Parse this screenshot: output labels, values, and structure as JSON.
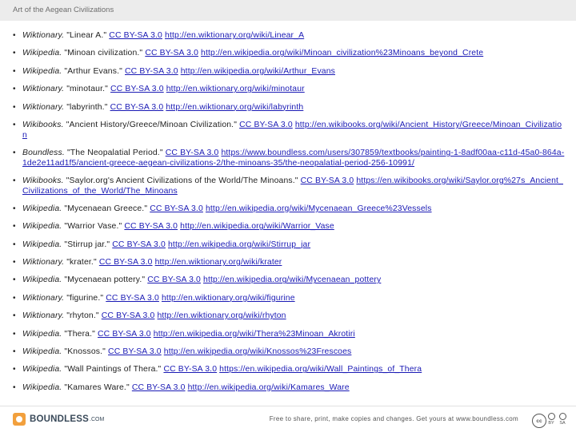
{
  "header": {
    "title": "Art of the Aegean Civilizations"
  },
  "references": [
    {
      "source": "Wiktionary.",
      "title": " \"Linear A.\" ",
      "license": "CC BY-SA 3.0",
      "url": "http://en.wiktionary.org/wiki/Linear_A"
    },
    {
      "source": "Wikipedia.",
      "title": " \"Minoan civilization.\" ",
      "license": "CC BY-SA 3.0",
      "url": "http://en.wikipedia.org/wiki/Minoan_civilization%23Minoans_beyond_Crete"
    },
    {
      "source": "Wikipedia.",
      "title": " \"Arthur Evans.\" ",
      "license": "CC BY-SA 3.0",
      "url": "http://en.wikipedia.org/wiki/Arthur_Evans"
    },
    {
      "source": "Wiktionary.",
      "title": " \"minotaur.\" ",
      "license": "CC BY-SA 3.0",
      "url": "http://en.wiktionary.org/wiki/minotaur"
    },
    {
      "source": "Wiktionary.",
      "title": " \"labyrinth.\" ",
      "license": "CC BY-SA 3.0",
      "url": "http://en.wiktionary.org/wiki/labyrinth"
    },
    {
      "source": "Wikibooks.",
      "title": " \"Ancient History/Greece/Minoan Civilization.\" ",
      "license": "CC BY-SA 3.0",
      "url": "http://en.wikibooks.org/wiki/Ancient_History/Greece/Minoan_Civilization"
    },
    {
      "source": "Boundless.",
      "title": " \"The Neopalatial Period.\" ",
      "license": "CC BY-SA 3.0",
      "url": "https://www.boundless.com/users/307859/textbooks/painting-1-8adf00aa-c11d-45a0-864a-1de2e11ad1f5/ancient-greece-aegean-civilizations-2/the-minoans-35/the-neopalatial-period-256-10991/"
    },
    {
      "source": "Wikibooks.",
      "title": " \"Saylor.org's Ancient Civilizations of the World/The Minoans.\" ",
      "license": "CC BY-SA 3.0",
      "url": "https://en.wikibooks.org/wiki/Saylor.org%27s_Ancient_Civilizations_of_the_World/The_Minoans"
    },
    {
      "source": "Wikipedia.",
      "title": " \"Mycenaean Greece.\" ",
      "license": "CC BY-SA 3.0",
      "url": "http://en.wikipedia.org/wiki/Mycenaean_Greece%23Vessels"
    },
    {
      "source": "Wikipedia.",
      "title": " \"Warrior Vase.\" ",
      "license": "CC BY-SA 3.0",
      "url": "http://en.wikipedia.org/wiki/Warrior_Vase"
    },
    {
      "source": "Wikipedia.",
      "title": " \"Stirrup jar.\" ",
      "license": "CC BY-SA 3.0",
      "url": "http://en.wikipedia.org/wiki/Stirrup_jar"
    },
    {
      "source": "Wiktionary.",
      "title": " \"krater.\" ",
      "license": "CC BY-SA 3.0",
      "url": "http://en.wiktionary.org/wiki/krater"
    },
    {
      "source": "Wikipedia.",
      "title": " \"Mycenaean pottery.\" ",
      "license": "CC BY-SA 3.0",
      "url": "http://en.wikipedia.org/wiki/Mycenaean_pottery"
    },
    {
      "source": "Wiktionary.",
      "title": " \"figurine.\" ",
      "license": "CC BY-SA 3.0",
      "url": "http://en.wiktionary.org/wiki/figurine"
    },
    {
      "source": "Wiktionary.",
      "title": " \"rhyton.\" ",
      "license": "CC BY-SA 3.0",
      "url": "http://en.wiktionary.org/wiki/rhyton"
    },
    {
      "source": "Wikipedia.",
      "title": " \"Thera.\" ",
      "license": "CC BY-SA 3.0",
      "url": "http://en.wikipedia.org/wiki/Thera%23Minoan_Akrotiri"
    },
    {
      "source": "Wikipedia.",
      "title": " \"Knossos.\" ",
      "license": "CC BY-SA 3.0",
      "url": "http://en.wikipedia.org/wiki/Knossos%23Frescoes"
    },
    {
      "source": "Wikipedia.",
      "title": " \"Wall Paintings of Thera.\" ",
      "license": "CC BY-SA 3.0",
      "url": "https://en.wikipedia.org/wiki/Wall_Paintings_of_Thera"
    },
    {
      "source": "Wikipedia.",
      "title": " \"Kamares Ware.\" ",
      "license": "CC BY-SA 3.0",
      "url": "http://en.wikipedia.org/wiki/Kamares_Ware"
    }
  ],
  "footer": {
    "logo_text": "BOUNDLESS",
    "logo_suffix": ".COM",
    "note": "Free to share, print, make copies and changes. Get yours at www.boundless.com",
    "cc_label": "cc",
    "by_label": "BY",
    "sa_label": "SA"
  },
  "colors": {
    "link": "#1a1ab5",
    "header_bg": "#ececec",
    "logo_accent": "#f2a03d"
  }
}
